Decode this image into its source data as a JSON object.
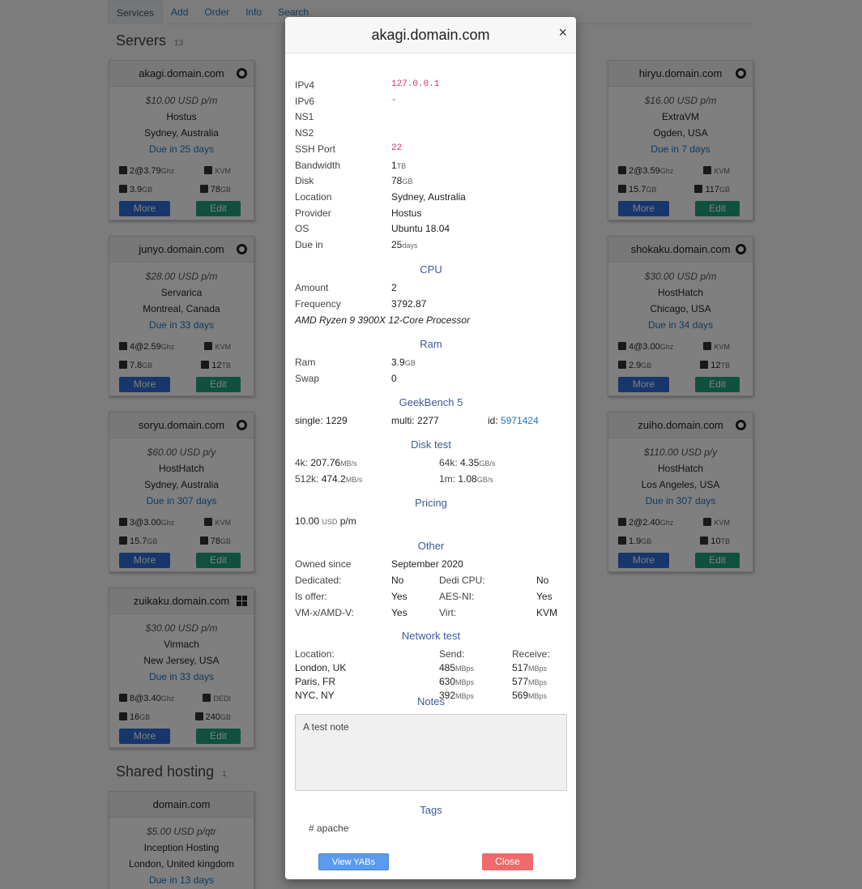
{
  "nav": {
    "tabs": [
      "Services",
      "Add",
      "Order",
      "Info",
      "Search"
    ]
  },
  "servers": {
    "title": "Servers",
    "count": "13",
    "cards": [
      {
        "host": "akagi.domain.com",
        "price": "$10.00 USD p/m",
        "provider": "Hostus",
        "location": "Sydney, Australia",
        "due": "Due in 25 days",
        "cpu": "2@3.79",
        "cpu_unit": "Ghz",
        "virt": "KVM",
        "ram": "3.9",
        "ram_unit": "GB",
        "disk": "78",
        "disk_unit": "GB",
        "more": "More",
        "edit": "Edit",
        "os": "linux"
      },
      {
        "host": "hiryu.domain.com",
        "price": "$16.00 USD p/m",
        "provider": "ExtraVM",
        "location": "Ogden, USA",
        "due": "Due in 7 days",
        "cpu": "2@3.59",
        "cpu_unit": "Ghz",
        "virt": "KVM",
        "ram": "15.7",
        "ram_unit": "GB",
        "disk": "117",
        "disk_unit": "GB",
        "more": "More",
        "edit": "Edit",
        "os": "linux"
      },
      {
        "host": "junyo.domain.com",
        "price": "$28.00 USD p/m",
        "provider": "Servarica",
        "location": "Montreal, Canada",
        "due": "Due in 33 days",
        "cpu": "4@2.59",
        "cpu_unit": "Ghz",
        "virt": "KVM",
        "ram": "7.8",
        "ram_unit": "GB",
        "disk": "12",
        "disk_unit": "TB",
        "more": "More",
        "edit": "Edit",
        "os": "linux"
      },
      {
        "host": "shokaku.domain.com",
        "price": "$30.00 USD p/m",
        "provider": "HostHatch",
        "location": "Chicago, USA",
        "due": "Due in 34 days",
        "cpu": "4@3.00",
        "cpu_unit": "Ghz",
        "virt": "KVM",
        "ram": "2.9",
        "ram_unit": "GB",
        "disk": "12",
        "disk_unit": "TB",
        "more": "More",
        "edit": "Edit",
        "os": "linux"
      },
      {
        "host": "soryu.domain.com",
        "price": "$60.00 USD p/y",
        "provider": "HostHatch",
        "location": "Sydney, Australia",
        "due": "Due in 307 days",
        "cpu": "3@3.00",
        "cpu_unit": "Ghz",
        "virt": "KVM",
        "ram": "15.7",
        "ram_unit": "GB",
        "disk": "78",
        "disk_unit": "GB",
        "more": "More",
        "edit": "Edit",
        "os": "linux"
      },
      {
        "host": "zuiho.domain.com",
        "price": "$110.00 USD p/y",
        "provider": "HostHatch",
        "location": "Los Angeles, USA",
        "due": "Due in 307 days",
        "cpu": "2@2.40",
        "cpu_unit": "Ghz",
        "virt": "KVM",
        "ram": "1.9",
        "ram_unit": "GB",
        "disk": "10",
        "disk_unit": "TB",
        "more": "More",
        "edit": "Edit",
        "os": "linux"
      },
      {
        "host": "zuikaku.domain.com",
        "price": "$30.00 USD p/m",
        "provider": "Virmach",
        "location": "New Jersey, USA",
        "due": "Due in 33 days",
        "cpu": "8@3.40",
        "cpu_unit": "Ghz",
        "virt": "DEDI",
        "ram": "16",
        "ram_unit": "GB",
        "disk": "240",
        "disk_unit": "GB",
        "more": "More",
        "edit": "Edit",
        "os": "windows"
      }
    ]
  },
  "shared": {
    "title": "Shared hosting",
    "count": "1",
    "card": {
      "host": "domain.com",
      "price": "$5.00 USD p/qtr",
      "provider": "Inception Hosting",
      "location": "London, United kingdom",
      "due": "Due in 13 days"
    }
  },
  "modal": {
    "title": "akagi.domain.com",
    "close_x": "×",
    "details": [
      {
        "k": "IPv4",
        "v": "127.0.0.1",
        "style": "pink"
      },
      {
        "k": "IPv6",
        "v": "-",
        "style": "pink"
      },
      {
        "k": "NS1",
        "v": ""
      },
      {
        "k": "NS2",
        "v": ""
      },
      {
        "k": "SSH Port",
        "v": "22",
        "style": "pink"
      },
      {
        "k": "Bandwidth",
        "v": "1",
        "unit": "TB"
      },
      {
        "k": "Disk",
        "v": "78",
        "unit": "GB"
      },
      {
        "k": "Location",
        "v": "Sydney, Australia"
      },
      {
        "k": "Provider",
        "v": "Hostus"
      },
      {
        "k": "OS",
        "v": "Ubuntu 18.04"
      },
      {
        "k": "Due in",
        "v": "25",
        "unit": "days"
      }
    ],
    "cpu": {
      "heading": "CPU",
      "amount_label": "Amount",
      "amount": "2",
      "freq_label": "Frequency",
      "freq": "3792.87",
      "model": "AMD Ryzen 9 3900X 12-Core Processor"
    },
    "ram": {
      "heading": "Ram",
      "ram_label": "Ram",
      "ram": "3.9",
      "ram_unit": "GB",
      "swap_label": "Swap",
      "swap": "0"
    },
    "geekbench": {
      "heading": "GeekBench 5",
      "single_label": "single:",
      "single": "1229",
      "multi_label": "multi:",
      "multi": "2277",
      "id_label": "id:",
      "id": "5971424"
    },
    "disk_test": {
      "heading": "Disk test",
      "rows": [
        {
          "l1": "4k:",
          "v1": "207.76",
          "u1": "MB/s",
          "l2": "64k:",
          "v2": "4.35",
          "u2": "GB/s"
        },
        {
          "l1": "512k:",
          "v1": "474.2",
          "u1": "MB/s",
          "l2": "1m:",
          "v2": "1.08",
          "u2": "GB/s"
        }
      ]
    },
    "pricing": {
      "heading": "Pricing",
      "amount": "10.00",
      "currency": "USD",
      "term": "p/m"
    },
    "other": {
      "heading": "Other",
      "owned_label": "Owned since",
      "owned": "September 2020",
      "rows": [
        {
          "k1": "Dedicated:",
          "v1": "No",
          "k2": "Dedi CPU:",
          "v2": "No"
        },
        {
          "k1": "Is offer:",
          "v1": "Yes",
          "k2": "AES-NI:",
          "v2": "Yes"
        },
        {
          "k1": "VM-x/AMD-V:",
          "v1": "Yes",
          "k2": "Virt:",
          "v2": "KVM"
        }
      ]
    },
    "network": {
      "heading": "Network test",
      "cols": [
        "Location:",
        "Send:",
        "Receive:"
      ],
      "rows": [
        {
          "loc": "London, UK",
          "send": "485",
          "recv": "517",
          "unit": "MBps"
        },
        {
          "loc": "Paris, FR",
          "send": "630",
          "recv": "577",
          "unit": "MBps"
        },
        {
          "loc": "NYC, NY",
          "send": "392",
          "recv": "569",
          "unit": "MBps"
        }
      ]
    },
    "notes": {
      "heading": "Notes",
      "text": "A test note"
    },
    "tags": {
      "heading": "Tags",
      "items": [
        "# apache"
      ]
    },
    "view_yabs": "View YABs",
    "close": "Close"
  }
}
